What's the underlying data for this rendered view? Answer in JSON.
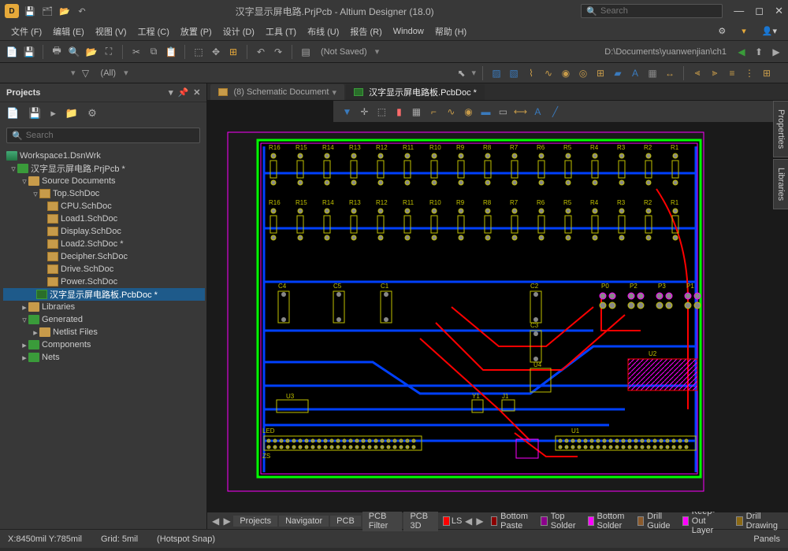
{
  "title": "汉字显示屏电路.PrjPcb - Altium Designer (18.0)",
  "search_ph": "Search",
  "menus": [
    "文件 (F)",
    "编辑 (E)",
    "视图 (V)",
    "工程 (C)",
    "放置 (P)",
    "设计 (D)",
    "工具 (T)",
    "布线 (U)",
    "报告 (R)",
    "Window",
    "帮助 (H)"
  ],
  "toolbar_notsaved": "(Not Saved)",
  "path": "D:\\Documents\\yuanwenjian\\ch1",
  "filter_all": "(All)",
  "panel_title": "Projects",
  "panel_search_ph": "Search",
  "tree": {
    "ws": "Workspace1.DsnWrk",
    "prj": "汉字显示屏电路.PrjPcb *",
    "src": "Source Documents",
    "top": "Top.SchDoc",
    "docs": [
      "CPU.SchDoc",
      "Load1.SchDoc",
      "Display.SchDoc",
      "Load2.SchDoc *",
      "Decipher.SchDoc",
      "Drive.SchDoc",
      "Power.SchDoc"
    ],
    "pcb": "汉字显示屏电路板.PcbDoc *",
    "lib": "Libraries",
    "gen": "Generated",
    "net": "Netlist Files",
    "comp": "Components",
    "nets": "Nets"
  },
  "tabs": {
    "sch": "(8) Schematic Document",
    "pcb": "汉字显示屏电路板.PcbDoc *"
  },
  "sidetabs": [
    "Properties",
    "Libraries"
  ],
  "btabs": [
    "Projects",
    "Navigator",
    "PCB",
    "PCB Filter",
    "PCB 3D"
  ],
  "ls": "LS",
  "layers": [
    {
      "c": "#8b0000",
      "n": "Bottom Paste"
    },
    {
      "c": "#8b008b",
      "n": "Top Solder"
    },
    {
      "c": "#ff00ff",
      "n": "Bottom Solder"
    },
    {
      "c": "#8b5a2b",
      "n": "Drill Guide"
    },
    {
      "c": "#ff00ff",
      "n": "Keep-Out Layer"
    },
    {
      "c": "#8b6914",
      "n": "Drill Drawing"
    }
  ],
  "status": {
    "coords": "X:8450mil Y:785mil",
    "grid": "Grid: 5mil",
    "snap": "(Hotspot Snap)",
    "panels": "Panels"
  },
  "refs_top": [
    "R16",
    "R15",
    "R14",
    "R13",
    "R12",
    "R11",
    "R10",
    "R9",
    "R8",
    "R7",
    "R6",
    "R5",
    "R4",
    "R3",
    "R2",
    "R1"
  ],
  "caps": [
    "C4",
    "C5",
    "C1",
    "C2",
    "C3"
  ],
  "conns": [
    "P0",
    "P2",
    "P3",
    "P1"
  ],
  "ics": [
    "U3",
    "Y1",
    "J1",
    "U4",
    "U1",
    "U2"
  ],
  "led": "LED",
  "zs": "ZS"
}
